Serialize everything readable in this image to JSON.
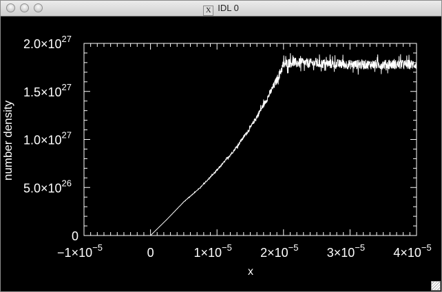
{
  "window": {
    "title": "IDL 0",
    "icon": "x11-icon"
  },
  "chart_data": {
    "type": "line",
    "title": "",
    "xlabel": "x",
    "ylabel": "number density",
    "xlim": [
      -1e-05,
      4e-05
    ],
    "ylim": [
      0,
      2e+27
    ],
    "x_ticks": [
      {
        "value": -1e-05,
        "mant": "−1×10",
        "exp": "−5"
      },
      {
        "value": 0,
        "mant": "0",
        "exp": ""
      },
      {
        "value": 1e-05,
        "mant": "1×10",
        "exp": "−5"
      },
      {
        "value": 2e-05,
        "mant": "2×10",
        "exp": "−5"
      },
      {
        "value": 3e-05,
        "mant": "3×10",
        "exp": "−5"
      },
      {
        "value": 4e-05,
        "mant": "4×10",
        "exp": "−5"
      }
    ],
    "y_ticks": [
      {
        "value": 0,
        "mant": "0",
        "exp": ""
      },
      {
        "value": 5e+26,
        "mant": "5.0×10",
        "exp": "26"
      },
      {
        "value": 1e+27,
        "mant": "1.0×10",
        "exp": "27"
      },
      {
        "value": 1.5e+27,
        "mant": "1.5×10",
        "exp": "27"
      },
      {
        "value": 2e+27,
        "mant": "2.0×10",
        "exp": "27"
      }
    ],
    "x_minor_step": 1e-06,
    "y_minor_step": 1e+26,
    "series": [
      {
        "name": "number density",
        "color": "#ffffff",
        "x": [
          0,
          2.5e-06,
          5e-06,
          7.5e-06,
          1e-05,
          1.25e-05,
          1.5e-05,
          1.75e-05,
          1.9e-05,
          2e-05,
          2.1e-05,
          3e-05,
          4e-05
        ],
        "y": [
          0,
          1.7e+26,
          3.5e+26,
          5e+26,
          6.8e+26,
          8.8e+26,
          1.12e+27,
          1.42e+27,
          1.62e+27,
          1.78e+27,
          1.8e+27,
          1.78e+27,
          1.78e+27
        ],
        "noise_amplitude_plateau": 5e+25
      }
    ],
    "grid": false,
    "legend": "none"
  }
}
